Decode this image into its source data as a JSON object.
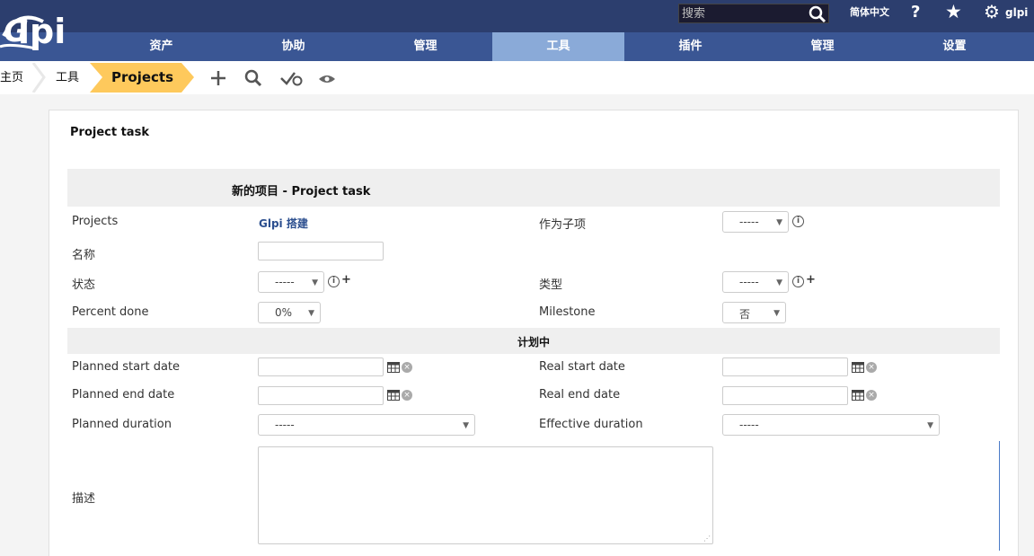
{
  "header": {
    "logo_text": "Glpi",
    "search_placeholder": "搜索",
    "language": "简体中文",
    "help": "?",
    "user": "glpi"
  },
  "menu": {
    "items": [
      {
        "label": "资产"
      },
      {
        "label": "协助"
      },
      {
        "label": "管理"
      },
      {
        "label": "工具"
      },
      {
        "label": "插件"
      },
      {
        "label": "管理"
      },
      {
        "label": "设置"
      }
    ],
    "active_index": 3
  },
  "breadcrumb": {
    "home": "主页",
    "section": "工具",
    "current": "Projects"
  },
  "toolbar": {
    "icons": [
      "add-icon",
      "search-icon",
      "checklist-icon",
      "eye-icon"
    ]
  },
  "panel": {
    "title": "Project task",
    "form_header": "新的项目 - Project task",
    "planning_header": "计划中"
  },
  "form": {
    "projects_label": "Projects",
    "projects_value": "Glpi 搭建",
    "parent_label": "作为子项",
    "parent_value": "-----",
    "name_label": "名称",
    "name_value": "",
    "state_label": "状态",
    "state_value": "-----",
    "type_label": "类型",
    "type_value": "-----",
    "percent_label": "Percent done",
    "percent_value": "0%",
    "milestone_label": "Milestone",
    "milestone_value": "否",
    "planned_start_label": "Planned start date",
    "planned_start_value": "",
    "real_start_label": "Real start date",
    "real_start_value": "",
    "planned_end_label": "Planned end date",
    "planned_end_value": "",
    "real_end_label": "Real end date",
    "real_end_value": "",
    "planned_duration_label": "Planned duration",
    "planned_duration_value": "-----",
    "effective_duration_label": "Effective duration",
    "effective_duration_value": "-----",
    "description_label": "描述",
    "description_value": ""
  },
  "colors": {
    "topbar": "#2c3e6e",
    "menubar": "#3a5694",
    "menu_active": "#8aaad8",
    "breadcrumb_active": "#fec95c"
  }
}
